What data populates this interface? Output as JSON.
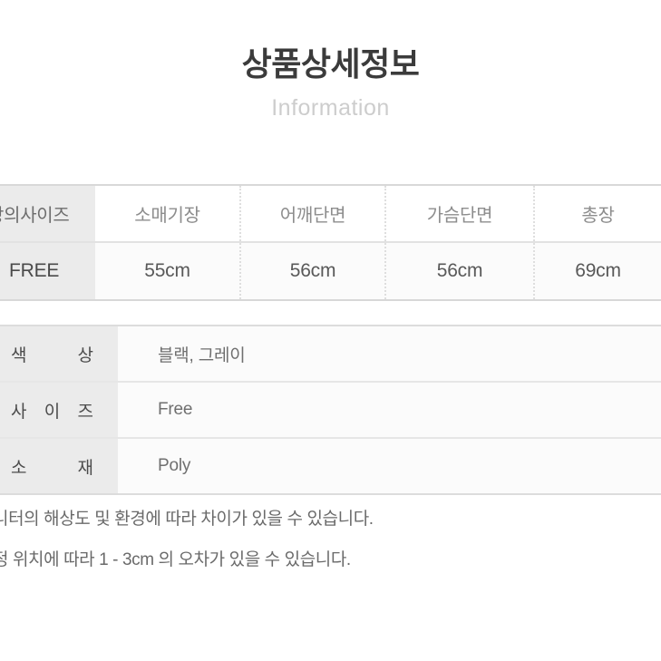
{
  "header": {
    "title": "상품상세정보",
    "subtitle": "Information"
  },
  "size_table": {
    "label_header": "상의사이즈",
    "columns": [
      "소매기장",
      "어깨단면",
      "가슴단면",
      "총장"
    ],
    "rows": [
      {
        "label": "FREE",
        "values": [
          "55cm",
          "56cm",
          "56cm",
          "69cm"
        ]
      }
    ]
  },
  "spec_table": {
    "rows": [
      {
        "label": "색 상",
        "label_chars": [
          "색",
          "상"
        ],
        "value": "블랙, 그레이"
      },
      {
        "label": "사 이 즈",
        "label_chars": [
          "사",
          "이",
          "즈"
        ],
        "value": "Free"
      },
      {
        "label": "소 재",
        "label_chars": [
          "소",
          "재"
        ],
        "value": "Poly"
      }
    ]
  },
  "notes": {
    "line1": "니터의 해상도 및 환경에 따라 차이가 있을 수 있습니다.",
    "line2": "정 위치에 따라 1 - 3cm 의 오차가 있을 수 있습니다."
  }
}
